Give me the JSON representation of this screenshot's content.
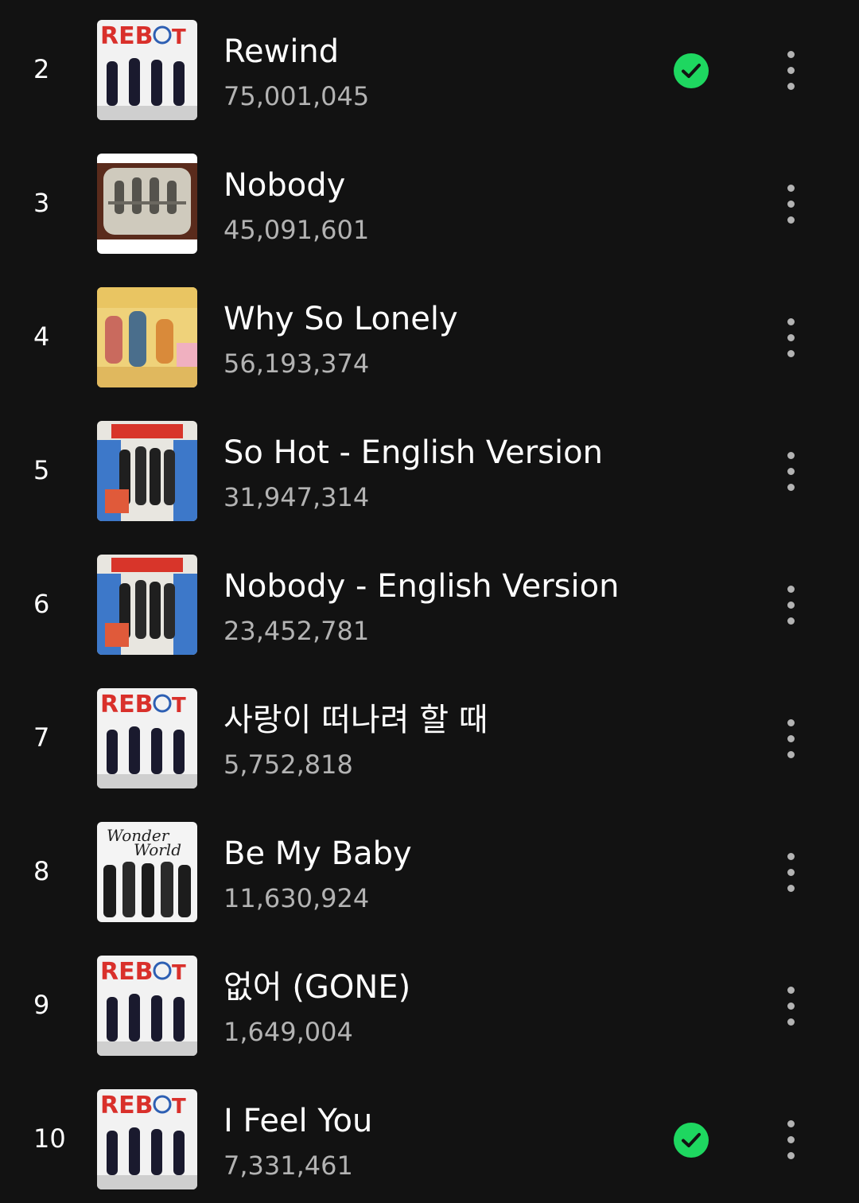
{
  "tracks": [
    {
      "rank": "2",
      "title": "Rewind",
      "plays": "75,001,045",
      "saved": true,
      "art": "reboot-album-art"
    },
    {
      "rank": "3",
      "title": "Nobody",
      "plays": "45,091,601",
      "saved": false,
      "art": "tv-album-art"
    },
    {
      "rank": "4",
      "title": "Why So Lonely",
      "plays": "56,193,374",
      "saved": false,
      "art": "why-so-lonely-album-art"
    },
    {
      "rank": "5",
      "title": "So Hot - English Version",
      "plays": "31,947,314",
      "saved": false,
      "art": "wonder-girls-album-art"
    },
    {
      "rank": "6",
      "title": "Nobody - English Version",
      "plays": "23,452,781",
      "saved": false,
      "art": "wonder-girls-album-art"
    },
    {
      "rank": "7",
      "title": "사랑이 떠나려 할 때",
      "plays": "5,752,818",
      "saved": false,
      "art": "reboot-album-art"
    },
    {
      "rank": "8",
      "title": "Be My Baby",
      "plays": "11,630,924",
      "saved": false,
      "art": "wonder-world-album-art"
    },
    {
      "rank": "9",
      "title": "없어 (GONE)",
      "plays": "1,649,004",
      "saved": false,
      "art": "reboot-album-art"
    },
    {
      "rank": "10",
      "title": "I Feel You",
      "plays": "7,331,461",
      "saved": true,
      "art": "reboot-album-art"
    }
  ],
  "icons": {
    "saved": "check-circle-icon",
    "more": "more-vertical-icon"
  },
  "colors": {
    "background": "#121212",
    "primary_text": "#ffffff",
    "secondary_text": "#b3b3b3",
    "saved_accent": "#1ed760"
  }
}
